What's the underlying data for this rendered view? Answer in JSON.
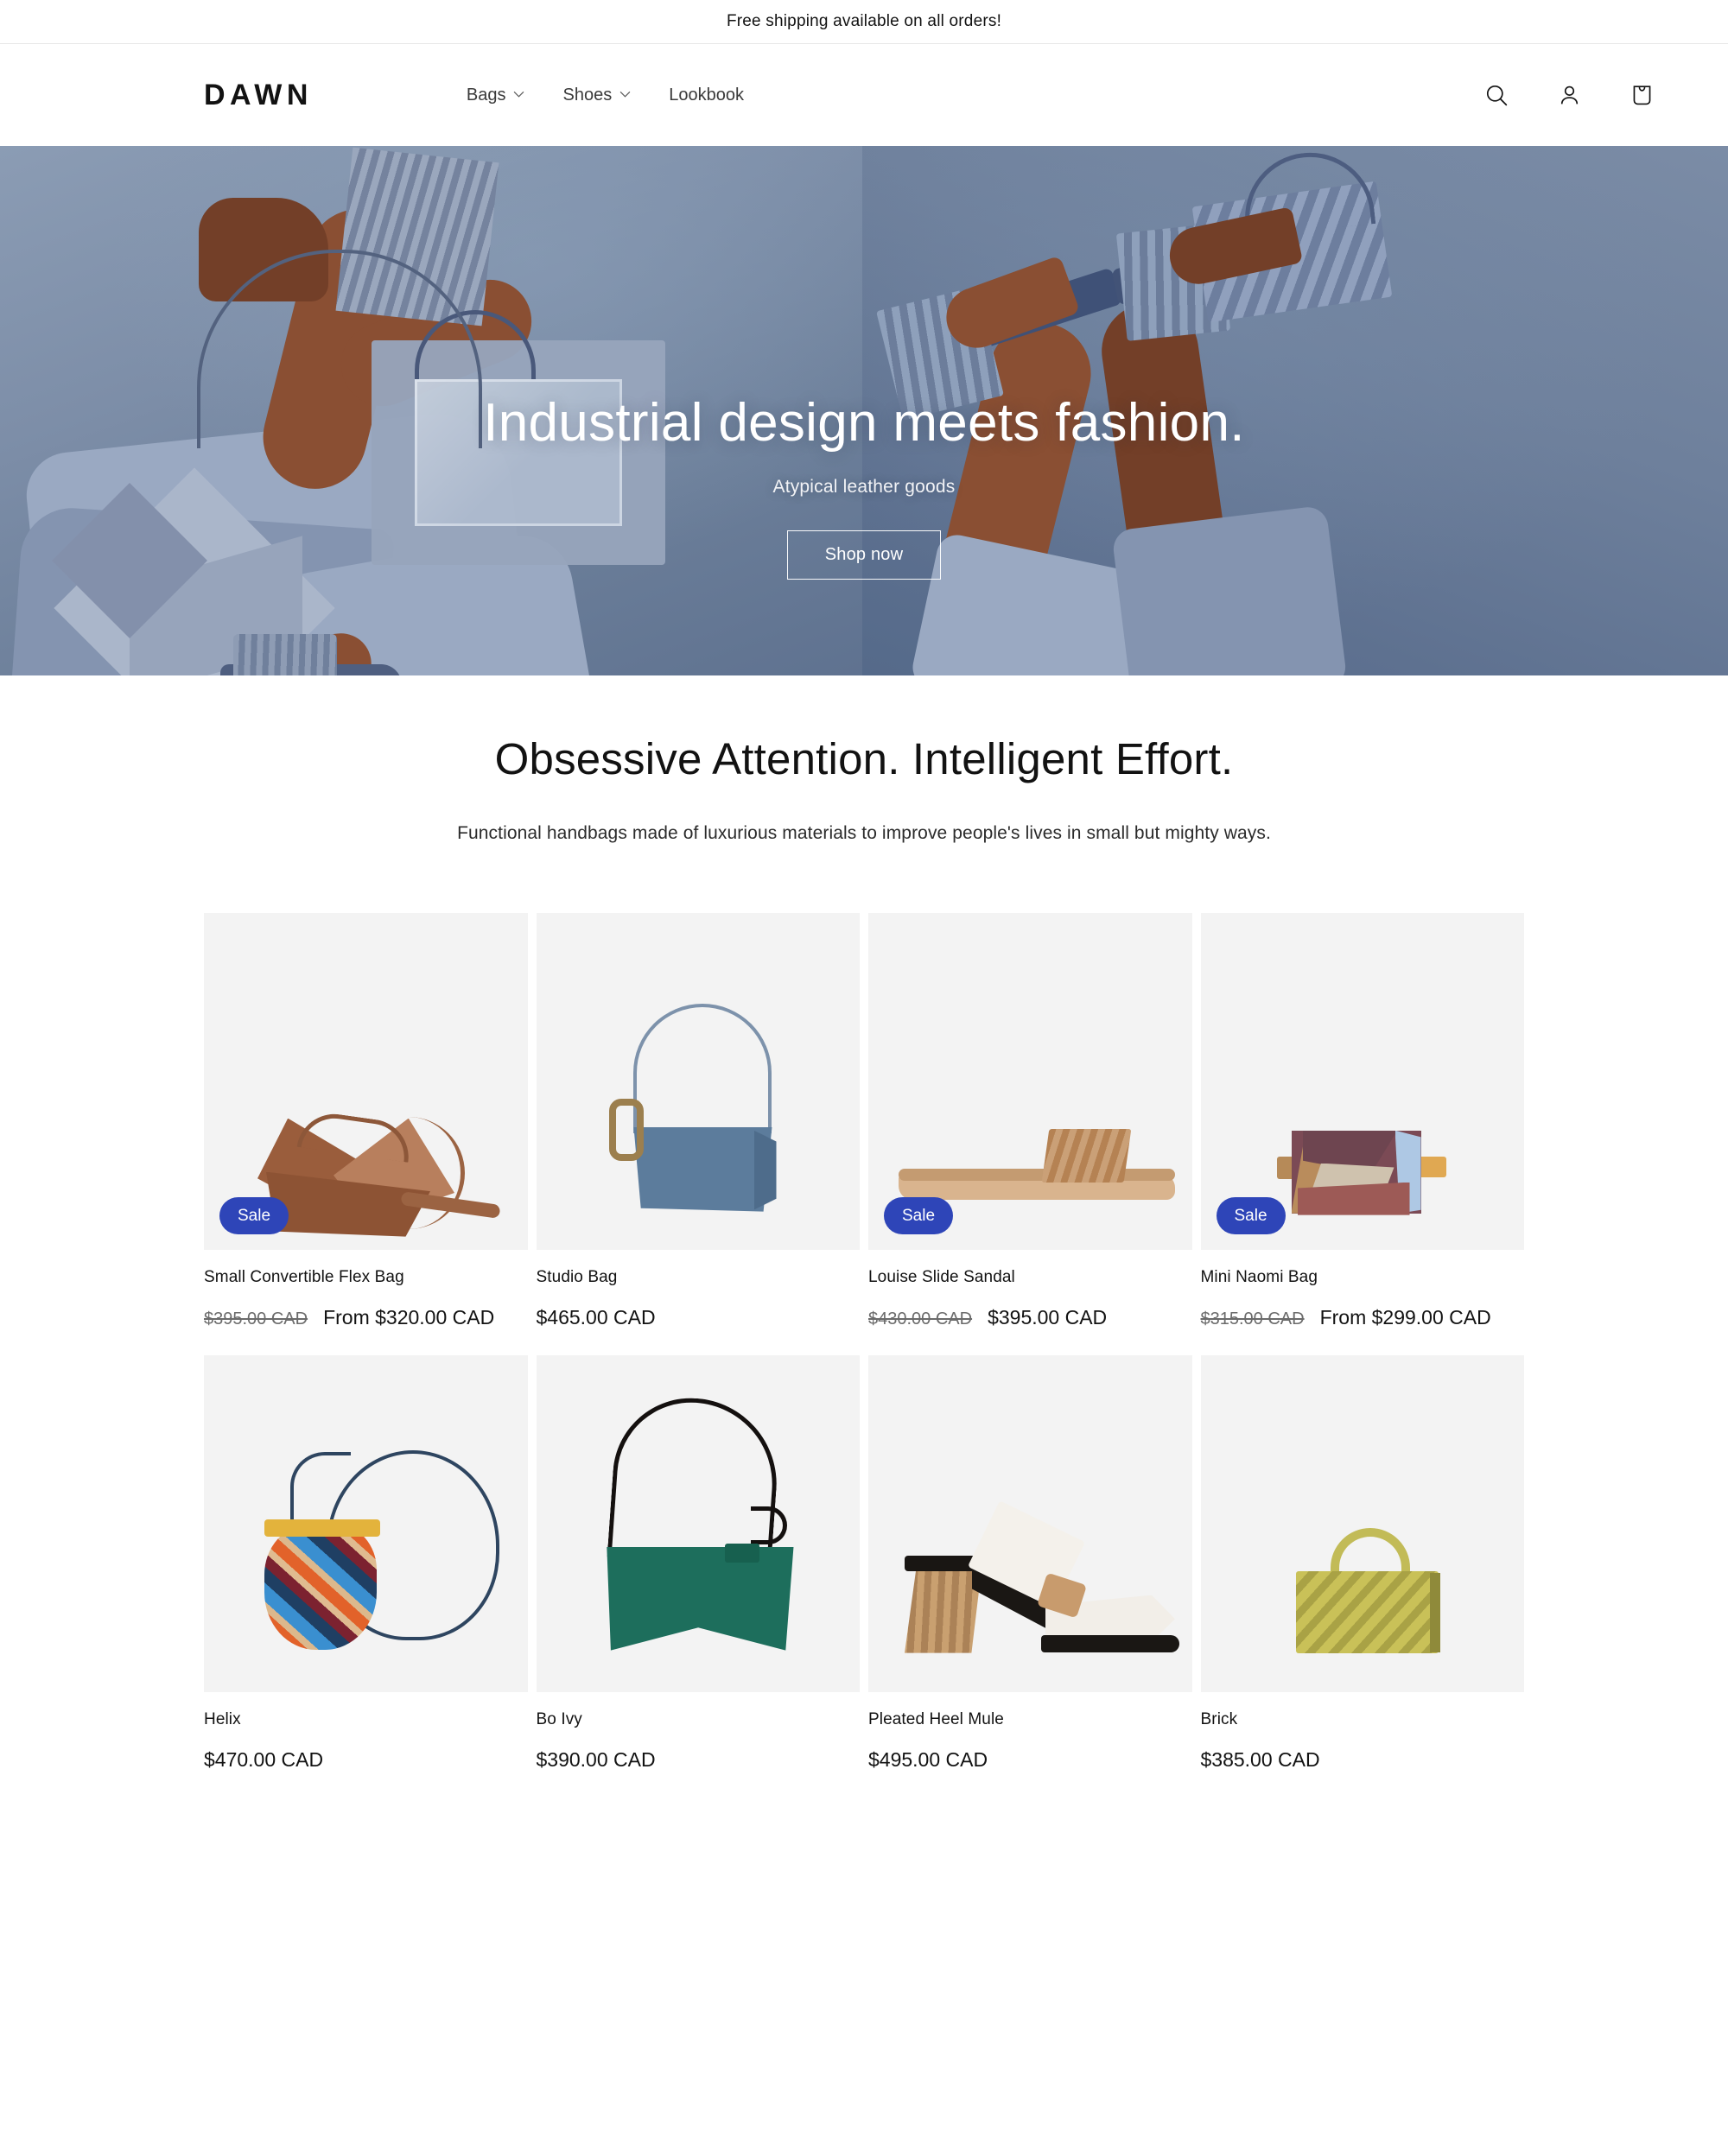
{
  "announcement": {
    "text": "Free shipping available on all orders!"
  },
  "header": {
    "logo": "DAWN",
    "nav": [
      {
        "label": "Bags",
        "has_dropdown": true,
        "icon": "chevron-down-icon"
      },
      {
        "label": "Shoes",
        "has_dropdown": true,
        "icon": "chevron-down-icon"
      },
      {
        "label": "Lookbook",
        "has_dropdown": false,
        "icon": ""
      }
    ],
    "actions": [
      {
        "name": "search-icon",
        "label": "Search"
      },
      {
        "name": "account-icon",
        "label": "Log in"
      },
      {
        "name": "cart-icon",
        "label": "Cart"
      }
    ]
  },
  "hero": {
    "title": "Industrial design meets fashion.",
    "subtitle": "Atypical leather goods",
    "button_label": "Shop now"
  },
  "featured": {
    "title": "Obsessive Attention. Intelligent Effort.",
    "subtitle": "Functional handbags made of luxurious materials to improve people's lives in small but mighty ways.",
    "sale_badge_label": "Sale",
    "sale_badge_color": "#2e45b8",
    "card_background": "#f3f3f3",
    "products": [
      {
        "title": "Small Convertible Flex Bag",
        "on_sale": true,
        "compare_price": "$395.00 CAD",
        "price": "From $320.00 CAD"
      },
      {
        "title": "Studio Bag",
        "on_sale": false,
        "compare_price": "",
        "price": "$465.00 CAD"
      },
      {
        "title": "Louise Slide Sandal",
        "on_sale": true,
        "compare_price": "$430.00 CAD",
        "price": "$395.00 CAD"
      },
      {
        "title": "Mini Naomi Bag",
        "on_sale": true,
        "compare_price": "$315.00 CAD",
        "price": "From $299.00 CAD"
      },
      {
        "title": "Helix",
        "on_sale": false,
        "compare_price": "",
        "price": "$470.00 CAD"
      },
      {
        "title": "Bo Ivy",
        "on_sale": false,
        "compare_price": "",
        "price": "$390.00 CAD"
      },
      {
        "title": "Pleated Heel Mule",
        "on_sale": false,
        "compare_price": "",
        "price": "$495.00 CAD"
      },
      {
        "title": "Brick",
        "on_sale": false,
        "compare_price": "",
        "price": "$385.00 CAD"
      }
    ]
  }
}
